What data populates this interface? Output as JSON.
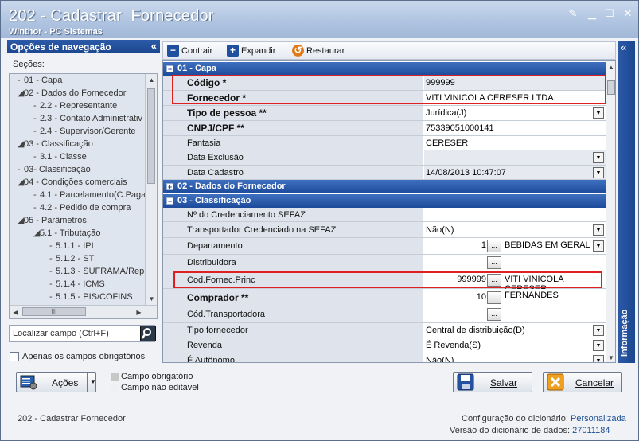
{
  "window": {
    "title": "202 - Cadastrar  Fornecedor",
    "subtitle": "Winthor - PC Sistemas"
  },
  "nav": {
    "header": "Opções de navegação",
    "sections_label": "Seções:",
    "items": [
      "01 - Capa",
      "02 - Dados do Fornecedor",
      "2.2 - Representante",
      "2.3 - Contato Administrativ",
      "2.4 - Supervisor/Gerente",
      "03 - Classificação",
      "3.1 - Classe",
      "03- Classificação",
      "04 - Condições comerciais",
      "4.1 - Parcelamento(C.Paga",
      "4.2 - Pedido de compra",
      "05 - Parâmetros",
      "5.1 - Tributação",
      "5.1.1 - IPI",
      "5.1.2 - ST",
      "5.1.3 - SUFRAMA/Rep",
      "5.1.4 - ICMS",
      "5.1.5 - PIS/COFINS"
    ],
    "scroll_thumb": "III",
    "locate_placeholder": "Localizar campo (Ctrl+F)",
    "only_required_label": "Apenas os campos obrigatórios"
  },
  "toolbar": {
    "collapse": "Contrair",
    "expand": "Expandir",
    "restore": "Restaurar"
  },
  "grid": {
    "sec1": "01 - Capa",
    "codigo_label": "Código *",
    "codigo_value": "999999",
    "fornecedor_label": "Fornecedor *",
    "fornecedor_value": "VITI VINICOLA CERESER LTDA.",
    "tipo_label": "Tipo de pessoa **",
    "tipo_value": "Jurídica(J)",
    "cnpj_label": "CNPJ/CPF **",
    "cnpj_value": "75339051000141",
    "fantasia_label": "Fantasia",
    "fantasia_value": "CERESER",
    "exclusao_label": "Data Exclusão",
    "cadastro_label": "Data Cadastro",
    "cadastro_value": "14/08/2013 10:47:07",
    "sec2": "02 - Dados do Fornecedor",
    "sec3": "03 - Classificação",
    "sefaz_label": "Nº do Credenciamento SEFAZ",
    "transp_sefaz_label": "Transportador Credenciado na SEFAZ",
    "transp_sefaz_value": "Não(N)",
    "depto_label": "Departamento",
    "depto_num": "1",
    "depto_value": "BEBIDAS EM GERAL",
    "distrib_label": "Distribuidora",
    "codprinc_label": "Cod.Fornec.Princ",
    "codprinc_num": "999999",
    "codprinc_value": "VITI VINICOLA CERESER",
    "comprador_label": "Comprador **",
    "comprador_num": "10",
    "comprador_value": "FERNANDES",
    "codtransp_label": "Cód.Transportadora",
    "tipoforn_label": "Tipo fornecedor",
    "tipoforn_value": "Central de distribuição(D)",
    "revenda_label": "Revenda",
    "revenda_value": "É Revenda(S)",
    "autonomo_label": "É Autônomo",
    "autonomo_value": "Não(N)",
    "ellipsis": "..."
  },
  "info_panel": "Informação",
  "actions": {
    "label": "Ações",
    "save": "Salvar",
    "cancel": "Cancelar"
  },
  "legend": {
    "required": "Campo obrigatório",
    "not_editable": "Campo não editável"
  },
  "footer": {
    "left": "202 - Cadastrar  Fornecedor",
    "dict_config_label": "Configuração do dicionário:",
    "dict_config_value": "Personalizada",
    "dict_version_label": "Versão do dicionário de dados:",
    "dict_version_value": "27011184"
  },
  "colors": {
    "accent": "#1d4b9a",
    "highlight": "#e02020"
  }
}
